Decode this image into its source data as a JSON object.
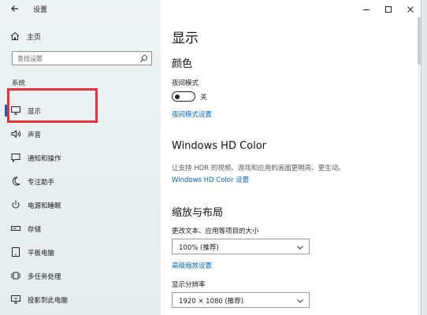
{
  "app": {
    "title": "设置"
  },
  "window": {
    "minimize_icon": "minimize-icon",
    "maximize_icon": "maximize-icon",
    "close_icon": "close-icon"
  },
  "sidebar": {
    "home_label": "主页",
    "search_placeholder": "查找设置",
    "section_title": "系统",
    "items": [
      {
        "label": "显示",
        "icon": "monitor-icon",
        "active": true
      },
      {
        "label": "声音",
        "icon": "speaker-icon"
      },
      {
        "label": "通知和操作",
        "icon": "notification-icon"
      },
      {
        "label": "专注助手",
        "icon": "moon-icon"
      },
      {
        "label": "电源和睡眠",
        "icon": "power-icon"
      },
      {
        "label": "存储",
        "icon": "storage-icon"
      },
      {
        "label": "平板电脑",
        "icon": "tablet-icon"
      },
      {
        "label": "多任务处理",
        "icon": "multitask-icon"
      },
      {
        "label": "投影到此电脑",
        "icon": "projector-icon"
      }
    ]
  },
  "main": {
    "title": "显示",
    "color_section": "颜色",
    "night_mode_label": "夜间模式",
    "night_mode_state": "关",
    "night_mode_link": "夜间模式设置",
    "hdr_section": "Windows HD Color",
    "hdr_desc": "让支持 HDR 的视频、游戏和应用的画面更明亮、更生动。",
    "hdr_link": "Windows HD Color 设置",
    "scale_section": "缩放与布局",
    "scale_label": "更改文本、应用等项目的大小",
    "scale_value": "100% (推荐)",
    "advanced_scale_link": "高级缩放设置",
    "resolution_label": "显示分辨率",
    "resolution_value": "1920 × 1080 (推荐)"
  },
  "colors": {
    "accent": "#0067c0",
    "highlight": "#e8323d"
  }
}
